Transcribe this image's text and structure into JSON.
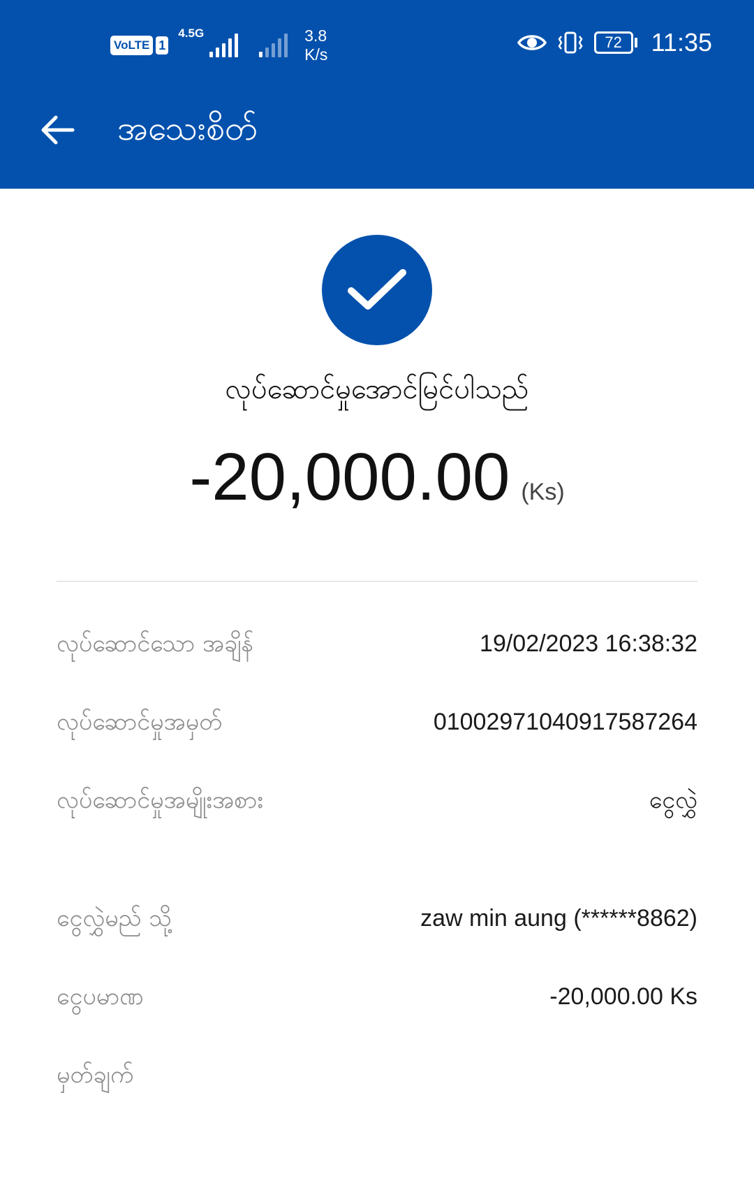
{
  "status_bar": {
    "volte": "VoLTE",
    "sim": "1",
    "network_type": "4.5G",
    "speed": "3.8\nK/s",
    "speed_value": "3.8",
    "speed_unit": "K/s",
    "battery": "72",
    "time": "11:35",
    "icons": [
      "eye-icon",
      "vibrate-icon",
      "battery-icon"
    ]
  },
  "header": {
    "title": "အသေးစိတ်",
    "back_icon": "arrow-left-icon"
  },
  "result": {
    "icon": "check-icon",
    "status": "လုပ်ဆောင်မှုအောင်မြင်ပါသည်",
    "amount": "-20,000.00",
    "currency": "(Ks)"
  },
  "details": [
    {
      "label": "လုပ်ဆောင်သော အချိန်",
      "value": "19/02/2023 16:38:32"
    },
    {
      "label": "လုပ်ဆောင်မှုအမှတ်",
      "value": "01002971040917587264"
    },
    {
      "label": "လုပ်ဆောင်မှုအမျိုးအစား",
      "value": "ငွေလွှဲ"
    },
    {
      "label": "ငွေလွှဲမည် သို့",
      "value": "zaw min aung (******8862)"
    },
    {
      "label": "ငွေပမာဏ",
      "value": "-20,000.00 Ks"
    },
    {
      "label": "မှတ်ချက်",
      "value": ""
    }
  ],
  "colors": {
    "primary": "#0451ad",
    "label_gray": "#8a8a8a",
    "divider": "#e6e6e6"
  }
}
